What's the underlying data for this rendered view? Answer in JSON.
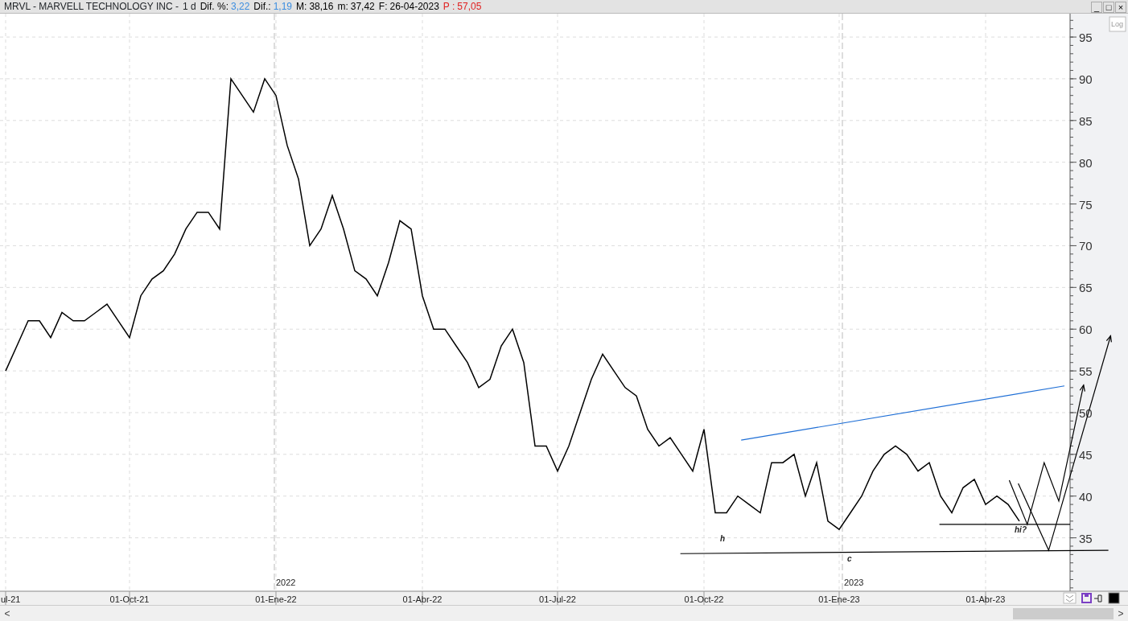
{
  "header": {
    "symbol": "MRVL - MARVELL TECHNOLOGY INC -",
    "period": "1 d",
    "fields": [
      {
        "label": "Dif. %:",
        "value": "3,22",
        "kind": "change"
      },
      {
        "label": "Dif.:",
        "value": "1,19",
        "kind": "change"
      },
      {
        "label": "M:",
        "value": "38,16",
        "kind": "plain"
      },
      {
        "label": "m:",
        "value": "37,42",
        "kind": "plain"
      },
      {
        "label": "F:",
        "value": "26-04-2023",
        "kind": "plain"
      },
      {
        "label": "P :",
        "value": "57,05",
        "kind": "alert"
      }
    ]
  },
  "window_controls": [
    "_",
    "□",
    "×"
  ],
  "scale_button": "Log",
  "chart_data": {
    "type": "line",
    "categories": [
      "ul-21",
      null,
      null,
      null,
      null,
      null,
      null,
      null,
      null,
      null,
      null,
      "01-Oct-21",
      null,
      null,
      null,
      null,
      null,
      null,
      null,
      null,
      null,
      null,
      null,
      null,
      "01-Ene-22",
      null,
      null,
      null,
      null,
      null,
      null,
      null,
      null,
      null,
      null,
      null,
      null,
      "01-Abr-22",
      null,
      null,
      null,
      null,
      null,
      null,
      null,
      null,
      null,
      null,
      null,
      "01-Jul-22",
      null,
      null,
      null,
      null,
      null,
      null,
      null,
      null,
      null,
      null,
      null,
      null,
      "01-Oct-22",
      null,
      null,
      null,
      null,
      null,
      null,
      null,
      null,
      null,
      null,
      null,
      "01-Ene-23",
      null,
      null,
      null,
      null,
      null,
      null,
      null,
      null,
      null,
      null,
      null,
      null,
      "01-Abr-23",
      null,
      null,
      null,
      null,
      null,
      null,
      null
    ],
    "series": [
      {
        "color": "#000000",
        "values": [
          55,
          58,
          61,
          61,
          59,
          62,
          61,
          61,
          62,
          63,
          61,
          59,
          64,
          66,
          67,
          69,
          72,
          74,
          74,
          72,
          90,
          88,
          86,
          90,
          88,
          82,
          78,
          70,
          72,
          76,
          72,
          67,
          66,
          64,
          68,
          73,
          72,
          64,
          60,
          60,
          58,
          56,
          53,
          54,
          58,
          60,
          56,
          46,
          46,
          43,
          46,
          50,
          54,
          57,
          55,
          53,
          52,
          48,
          46,
          47,
          45,
          43,
          48,
          38,
          38,
          40,
          39,
          38,
          44,
          44,
          45,
          40,
          44,
          37,
          36,
          38,
          40,
          43,
          45,
          46,
          45,
          43,
          44,
          40,
          38,
          41,
          42,
          39,
          40,
          39,
          37,
          null,
          null,
          null,
          null
        ]
      }
    ],
    "grid": true,
    "ylim": [
      28.6,
      97.8
    ],
    "yticks": [
      35,
      40,
      45,
      50,
      55,
      60,
      65,
      70,
      75,
      80,
      85,
      90,
      95
    ],
    "annotations": [
      "2022",
      "2023",
      "h",
      "c",
      "hi?"
    ]
  },
  "footer_tools": [
    {
      "kind": "collapse"
    },
    {
      "kind": "save"
    },
    {
      "kind": "pin"
    },
    {
      "kind": "color"
    }
  ],
  "scrollbar": {
    "left": "<",
    "right": ">"
  }
}
